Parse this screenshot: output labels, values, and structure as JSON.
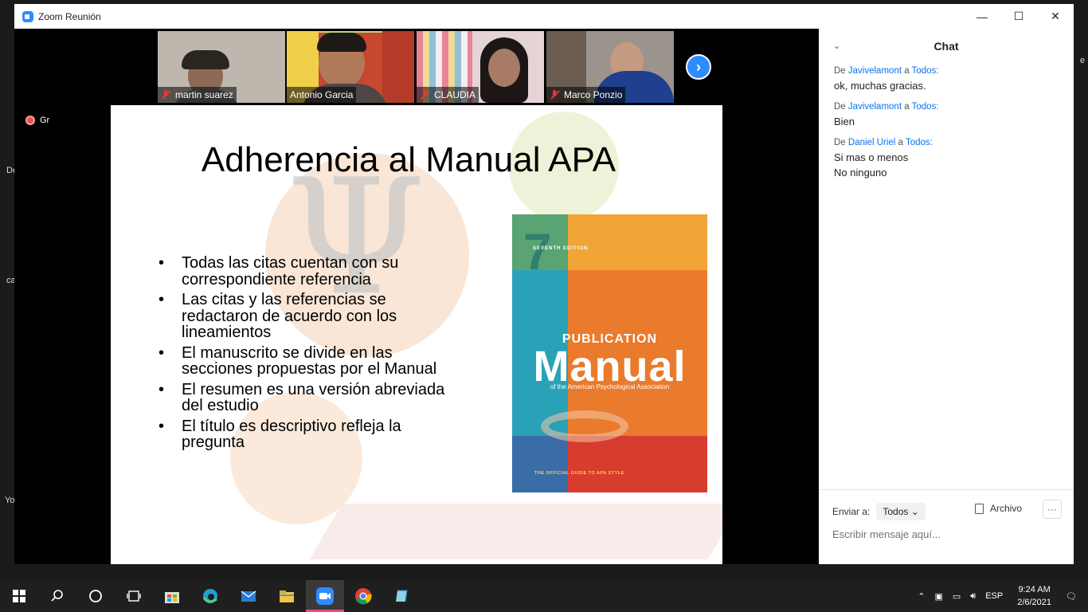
{
  "window": {
    "title": "Zoom Reunión",
    "minimize": "—",
    "maximize": "☐",
    "close": "✕"
  },
  "participants": [
    {
      "name": "martin suarez",
      "muted": true
    },
    {
      "name": "Antonio Garcia",
      "muted": false
    },
    {
      "name": "CLAUDIA",
      "muted": true
    },
    {
      "name": "Marco Ponzio",
      "muted": true
    }
  ],
  "next_page_icon": "›",
  "recording_label": "Grabando",
  "side_partial": {
    "left1": "De",
    "left2": "ca",
    "left3": "Yo",
    "right1": "e"
  },
  "slide": {
    "title": "Adherencia al Manual APA",
    "bullets": [
      "Todas las citas cuentan con su correspondiente referencia",
      "Las citas y las referencias se redactaron de acuerdo con los lineamientos",
      "El manuscrito se divide en las secciones propuestas por el Manual",
      "El resumen es una versión abreviada del estudio",
      "El título es descriptivo refleja la pregunta"
    ],
    "book": {
      "edition_number": "7",
      "edition_label": "SEVENTH EDITION",
      "publication": "PUBLICATION",
      "manual": "Manual",
      "association": "of the American Psychological Association",
      "tagline": "THE OFFICIAL GUIDE TO APA STYLE"
    }
  },
  "chat": {
    "title": "Chat",
    "messages": [
      {
        "prefix": "De",
        "from": "Javivelamont",
        "to_prefix": "a",
        "to": "Todos:",
        "lines": [
          "ok, muchas gracias."
        ]
      },
      {
        "prefix": "De",
        "from": "Javivelamont",
        "to_prefix": "a",
        "to": "Todos:",
        "lines": [
          "Bien"
        ]
      },
      {
        "prefix": "De",
        "from": "Daniel Uriel",
        "to_prefix": "a",
        "to": "Todos:",
        "lines": [
          "Si mas o menos",
          "No ninguno"
        ]
      }
    ],
    "send_to_label": "Enviar a:",
    "send_to_value": "Todos",
    "file_label": "Archivo",
    "more_label": "···",
    "input_placeholder": "Escribir mensaje aquí..."
  },
  "taskbar": {
    "lang": "ESP",
    "time": "9:24 AM",
    "date": "2/6/2021"
  },
  "colors": {
    "accent": "#2d8cff",
    "recording": "#e8544b",
    "active_speaker": "#b6d77a"
  }
}
